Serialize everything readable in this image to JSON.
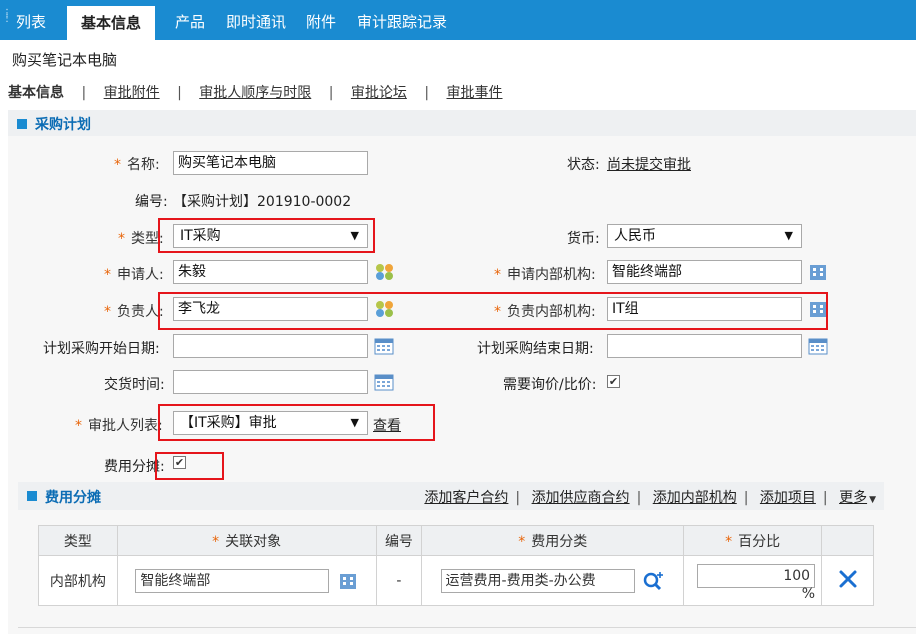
{
  "tabs": [
    {
      "label": "列表"
    },
    {
      "label": "基本信息"
    },
    {
      "label": "产品"
    },
    {
      "label": "即时通讯"
    },
    {
      "label": "附件"
    },
    {
      "label": "审计跟踪记录"
    }
  ],
  "doc_title": "购买笔记本电脑",
  "subnav": [
    "基本信息",
    "审批附件",
    "审批人顺序与时限",
    "审批论坛",
    "审批事件"
  ],
  "subnav_sep": "|",
  "section_title": "采购计划",
  "req_mark": "*",
  "form": {
    "name_label": "名称:",
    "name_value": "购买笔记本电脑",
    "status_label": "状态:",
    "status_value": "尚未提交审批",
    "number_label": "编号:",
    "number_value": "【采购计划】201910-0002",
    "type_label": "类型:",
    "type_value": "IT采购",
    "currency_label": "货币:",
    "currency_value": "人民币",
    "applicant_label": "申请人:",
    "applicant_value": "朱毅",
    "apply_org_label": "申请内部机构:",
    "apply_org_value": "智能终端部",
    "owner_label": "负责人:",
    "owner_value": "李飞龙",
    "owner_org_label": "负责内部机构:",
    "owner_org_value": "IT组",
    "start_date_label": "计划采购开始日期:",
    "start_date_value": "",
    "end_date_label": "计划采购结束日期:",
    "end_date_value": "",
    "delivery_label": "交货时间:",
    "delivery_value": "",
    "inquiry_label": "需要询价/比价:",
    "inquiry_checked": true,
    "approver_label": "审批人列表:",
    "approver_value": "【IT采购】审批",
    "view_link": "查看",
    "cost_share_label": "费用分摊:",
    "cost_share_checked": true
  },
  "cost_section": {
    "title": "费用分摊",
    "actions": [
      "添加客户合约",
      "添加供应商合约",
      "添加内部机构",
      "添加项目",
      "更多"
    ],
    "columns": [
      "类型",
      "关联对象",
      "编号",
      "费用分类",
      "百分比"
    ],
    "rows": [
      {
        "type": "内部机构",
        "object": "智能终端部",
        "number": "-",
        "category": "运营费用-费用类-办公费",
        "percent": "100",
        "unit": "%"
      }
    ]
  },
  "colors": {
    "accent": "#1a8bd1",
    "required": "#e8650a",
    "highlight_box": "#e5151b",
    "delete": "#1a6fd1"
  }
}
